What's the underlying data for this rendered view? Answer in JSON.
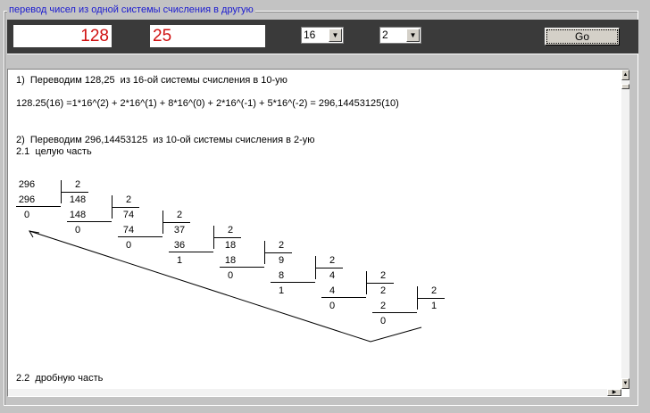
{
  "group_title": "перевод чисел из одной системы счисления в другую",
  "inputs": {
    "integer_part": "128",
    "fraction_part": "25"
  },
  "from_base": "16",
  "to_base": "2",
  "go_label": "Go",
  "output": {
    "line1": "1)  Переводим 128,25  из 16-ой системы счисления в 10-ую",
    "line2": "128.25(16) =1*16^(2) + 2*16^(1) + 8*16^(0) + 2*16^(-1) + 5*16^(-2) = 296,14453125(10)",
    "line3": "2)  Переводим 296,14453125  из 10-ой системы счисления в 2-ую",
    "line4": "2.1  целую часть",
    "line5": "2.2  дробную часть"
  },
  "division": {
    "divisor": "2",
    "start": "296",
    "steps": [
      {
        "quotient": "148",
        "subtracted": "296",
        "remainder": "0"
      },
      {
        "quotient": "74",
        "subtracted": "148",
        "remainder": "0"
      },
      {
        "quotient": "37",
        "subtracted": "74",
        "remainder": "0"
      },
      {
        "quotient": "18",
        "subtracted": "36",
        "remainder": "1"
      },
      {
        "quotient": "9",
        "subtracted": "18",
        "remainder": "0"
      },
      {
        "quotient": "4",
        "subtracted": "8",
        "remainder": "1"
      },
      {
        "quotient": "2",
        "subtracted": "4",
        "remainder": "0"
      },
      {
        "quotient": "1",
        "subtracted": "2",
        "remainder": "0"
      }
    ]
  }
}
